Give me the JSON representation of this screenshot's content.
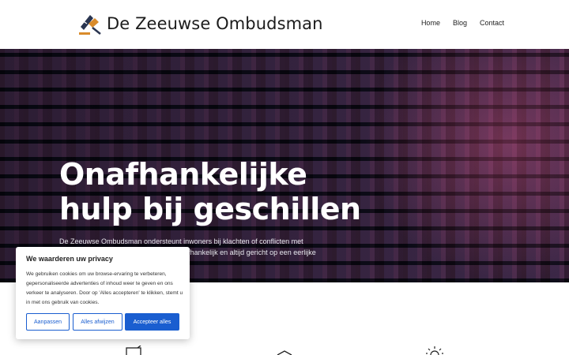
{
  "header": {
    "brand": "De Zeeuwse Ombudsman",
    "nav": [
      "Home",
      "Blog",
      "Contact"
    ]
  },
  "hero": {
    "title_line1": "Onafhankelijke",
    "title_line2": "hulp bij geschillen",
    "text": "De Zeeuwse Ombudsman ondersteunt inwoners bij klachten of conflicten met overheden en instanties. Deskundig, onafhankelijk en altijd gericht op een eerlijke oplossing."
  },
  "cookie": {
    "title": "We waarderen uw privacy",
    "body": "We gebruiken cookies om uw browse-ervaring te verbeteren, gepersonaliseerde advertenties of inhoud weer te geven en ons verkeer te analyseren. Door op 'Alles accepteren' te klikken, stemt u in met ons gebruik van cookies.",
    "customize": "Aanpassen",
    "reject": "Alles afwijzen",
    "accept": "Accepteer alles"
  },
  "colors": {
    "accent": "#1a5ed0",
    "logo_orange": "#d98b2b",
    "logo_navy": "#2a3550"
  },
  "icons": [
    "logo-gavel-icon",
    "document-icon",
    "house-icon",
    "lightbulb-icon"
  ]
}
